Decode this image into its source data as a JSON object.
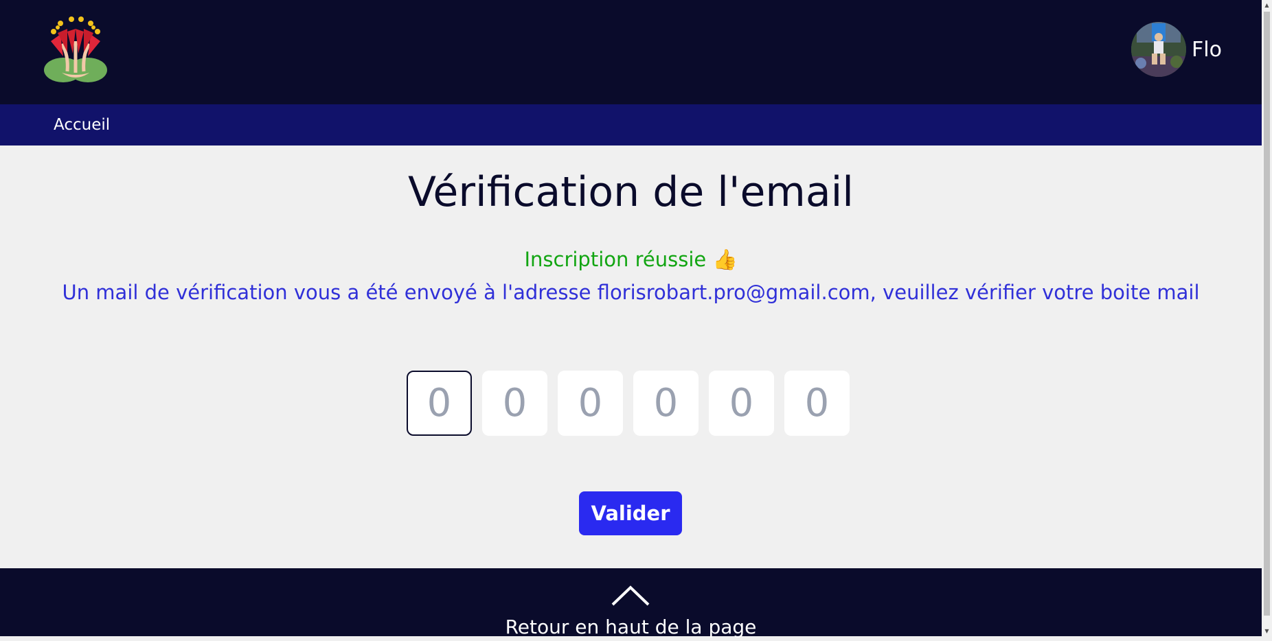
{
  "header": {
    "user_name": "Flo"
  },
  "nav": {
    "home_label": "Accueil"
  },
  "main": {
    "title": "Vérification de l'email",
    "success_message": "Inscription réussie 👍",
    "info_message": "Un mail de vérification vous a été envoyé à l'adresse florisrobart.pro@gmail.com, veuillez vérifier votre boite mail",
    "otp_placeholder": "0",
    "validate_label": "Valider"
  },
  "footer": {
    "back_to_top_label": "Retour en haut de la page"
  },
  "colors": {
    "header_bg": "#0a0b2b",
    "nav_bg": "#11126a",
    "success": "#12a512",
    "info": "#3030d8",
    "button": "#2a2af0"
  }
}
